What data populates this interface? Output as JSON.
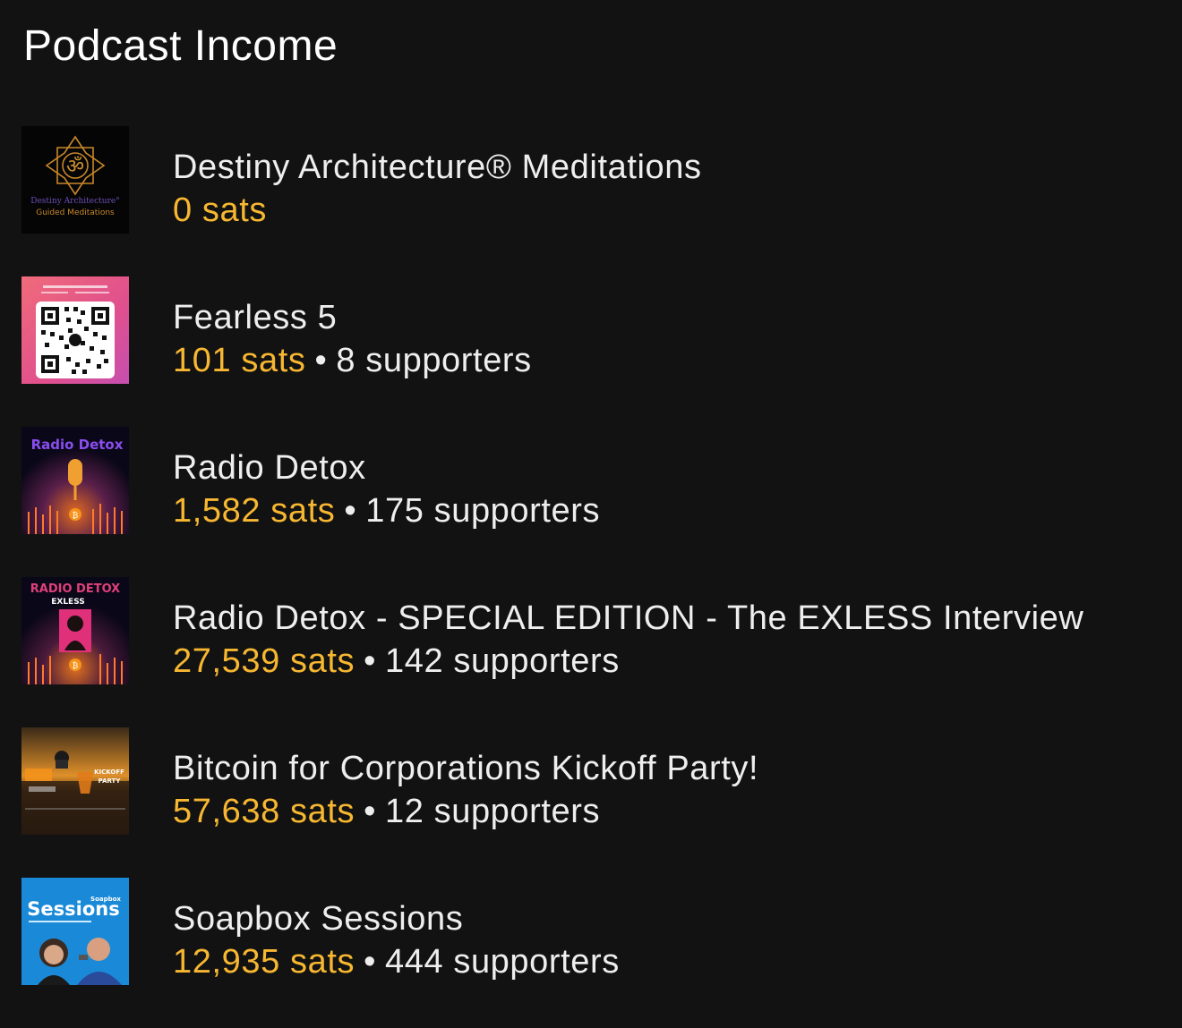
{
  "page": {
    "title": "Podcast Income"
  },
  "colors": {
    "background": "#121212",
    "sats": "#f7b731",
    "text": "#eeeeee"
  },
  "podcasts": [
    {
      "name": "Destiny Architecture® Meditations",
      "sats": "0 sats",
      "supporters": "",
      "thumb_text_1": "Destiny Architecture°",
      "thumb_text_2": "Guided Meditations",
      "thumb_icon": "om-mandala-icon"
    },
    {
      "name": "Fearless 5",
      "sats": "101 sats",
      "supporters": "8 supporters",
      "thumb_icon": "qr-code-icon"
    },
    {
      "name": "Radio Detox",
      "sats": "1,582 sats",
      "supporters": "175 supporters",
      "thumb_text_1": "Radio Detox",
      "thumb_icon": "microphone-icon"
    },
    {
      "name": "Radio Detox - SPECIAL EDITION - The EXLESS Interview",
      "sats": "27,539 sats",
      "supporters": "142 supporters",
      "thumb_text_1": "RADIO DETOX",
      "thumb_text_2": "EXLESS",
      "thumb_icon": "portrait-icon"
    },
    {
      "name": "Bitcoin for Corporations Kickoff Party!",
      "sats": "57,638 sats",
      "supporters": "12 supporters",
      "thumb_text_1": "KICKOFF",
      "thumb_text_2": "PARTY",
      "thumb_icon": "cocktail-icon"
    },
    {
      "name": "Soapbox Sessions",
      "sats": "12,935 sats",
      "supporters": "444 supporters",
      "thumb_text_1": "Sessions",
      "thumb_text_2": "Soapbox",
      "thumb_icon": "hosts-photo-icon"
    }
  ]
}
